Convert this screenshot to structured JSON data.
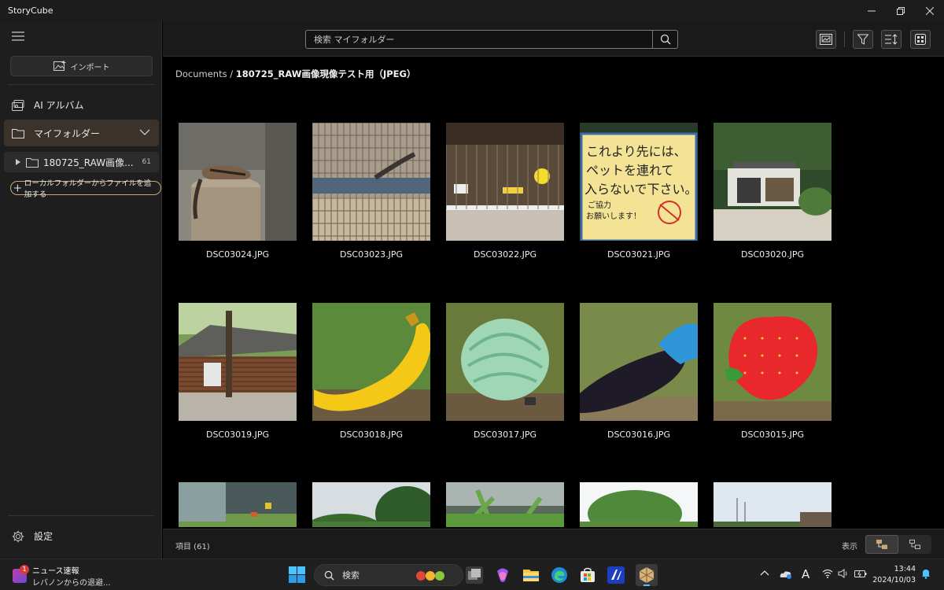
{
  "window": {
    "title": "StoryCube"
  },
  "sidebar": {
    "import_label": "インポート",
    "ai_album_label": "AI アルバム",
    "my_folder_label": "マイフォルダー",
    "folder": {
      "name": "180725_RAW画像...",
      "count": "61"
    },
    "add_local_label": "ローカルフォルダーからファイルを追加する",
    "settings_label": "設定"
  },
  "toolbar": {
    "search_placeholder": "検索 マイフォルダー"
  },
  "breadcrumb": {
    "root": "Documents",
    "separator": " / ",
    "current": "180725_RAW画像現像テスト用（JPEG）"
  },
  "files": [
    {
      "name": "DSC03024.JPG",
      "kind": "chipmunk"
    },
    {
      "name": "DSC03023.JPG",
      "kind": "cage"
    },
    {
      "name": "DSC03022.JPG",
      "kind": "enclosure"
    },
    {
      "name": "DSC03021.JPG",
      "kind": "sign"
    },
    {
      "name": "DSC03020.JPG",
      "kind": "building"
    },
    {
      "name": "DSC03019.JPG",
      "kind": "loghouse"
    },
    {
      "name": "DSC03018.JPG",
      "kind": "banana"
    },
    {
      "name": "DSC03017.JPG",
      "kind": "cabbage"
    },
    {
      "name": "DSC03016.JPG",
      "kind": "eggplant"
    },
    {
      "name": "DSC03015.JPG",
      "kind": "strawberry"
    },
    {
      "name": "",
      "kind": "greenhouse"
    },
    {
      "name": "",
      "kind": "trees"
    },
    {
      "name": "",
      "kind": "palms"
    },
    {
      "name": "",
      "kind": "bigtree"
    },
    {
      "name": "",
      "kind": "sky"
    }
  ],
  "sign_text": {
    "line1": "これより先には、",
    "line2": "ペットを連れて",
    "line3": "入らないで下さい。",
    "line4": "ご協力",
    "line5": "お願いします！"
  },
  "status": {
    "item_count": "項目 (61)",
    "view_label": "表示"
  },
  "taskbar": {
    "news_badge": "1",
    "news_title": "ニュース速報",
    "news_sub": "レバノンからの退避...",
    "search_label": "検索",
    "time": "13:44",
    "date": "2024/10/03",
    "ime": "A"
  }
}
